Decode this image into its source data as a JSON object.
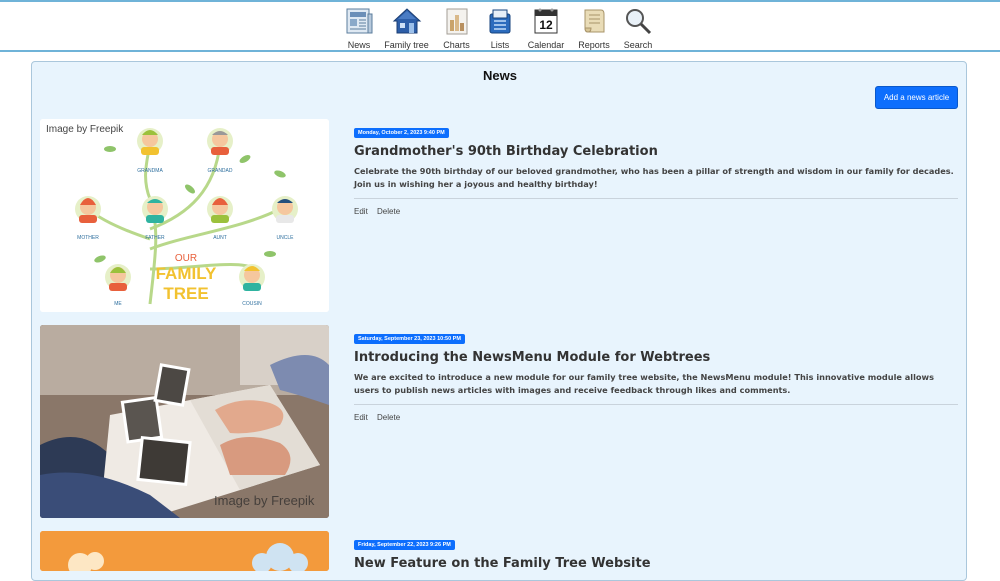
{
  "menu": [
    {
      "label": "News",
      "icon": "news-icon"
    },
    {
      "label": "Family tree",
      "icon": "house-icon"
    },
    {
      "label": "Charts",
      "icon": "charts-icon"
    },
    {
      "label": "Lists",
      "icon": "lists-icon"
    },
    {
      "label": "Calendar",
      "icon": "calendar-icon",
      "day": "12"
    },
    {
      "label": "Reports",
      "icon": "reports-icon"
    },
    {
      "label": "Search",
      "icon": "search-icon"
    }
  ],
  "page": {
    "title": "News",
    "add_button": "Add a news article"
  },
  "articles": [
    {
      "date": "Monday, October 2, 2023 9:40 PM",
      "title": "Grandmother's 90th Birthday Celebration",
      "text": "Celebrate the 90th birthday of our beloved grandmother, who has been a pillar of strength and wisdom in our family for decades. Join us in wishing her a joyous and healthy birthday!",
      "image_caption": "Image by Freepik",
      "tree_labels": {
        "grandma": "GRANDMA",
        "grandad": "GRANDAD",
        "mother": "MOTHER",
        "father": "FATHER",
        "aunt": "AUNT",
        "uncle": "UNCLE",
        "me": "ME",
        "cousin": "COUSIN",
        "our": "OUR",
        "family": "FAMILY",
        "tree": "TREE"
      },
      "edit": "Edit",
      "delete": "Delete"
    },
    {
      "date": "Saturday, September 23, 2023 10:50 PM",
      "title": "Introducing the NewsMenu Module for Webtrees",
      "text": "We are excited to introduce a new module for our family tree website, the NewsMenu module! This innovative module allows users to publish news articles with images and receive feedback through likes and comments.",
      "image_caption": "Image by Freepik",
      "edit": "Edit",
      "delete": "Delete"
    },
    {
      "date": "Friday, September 22, 2023 9:26 PM",
      "title": "New Feature on the Family Tree Website"
    }
  ],
  "colors": {
    "accent": "#0d6efd",
    "panel": "#e8f4fd",
    "menu_border": "#6fb3d8"
  }
}
